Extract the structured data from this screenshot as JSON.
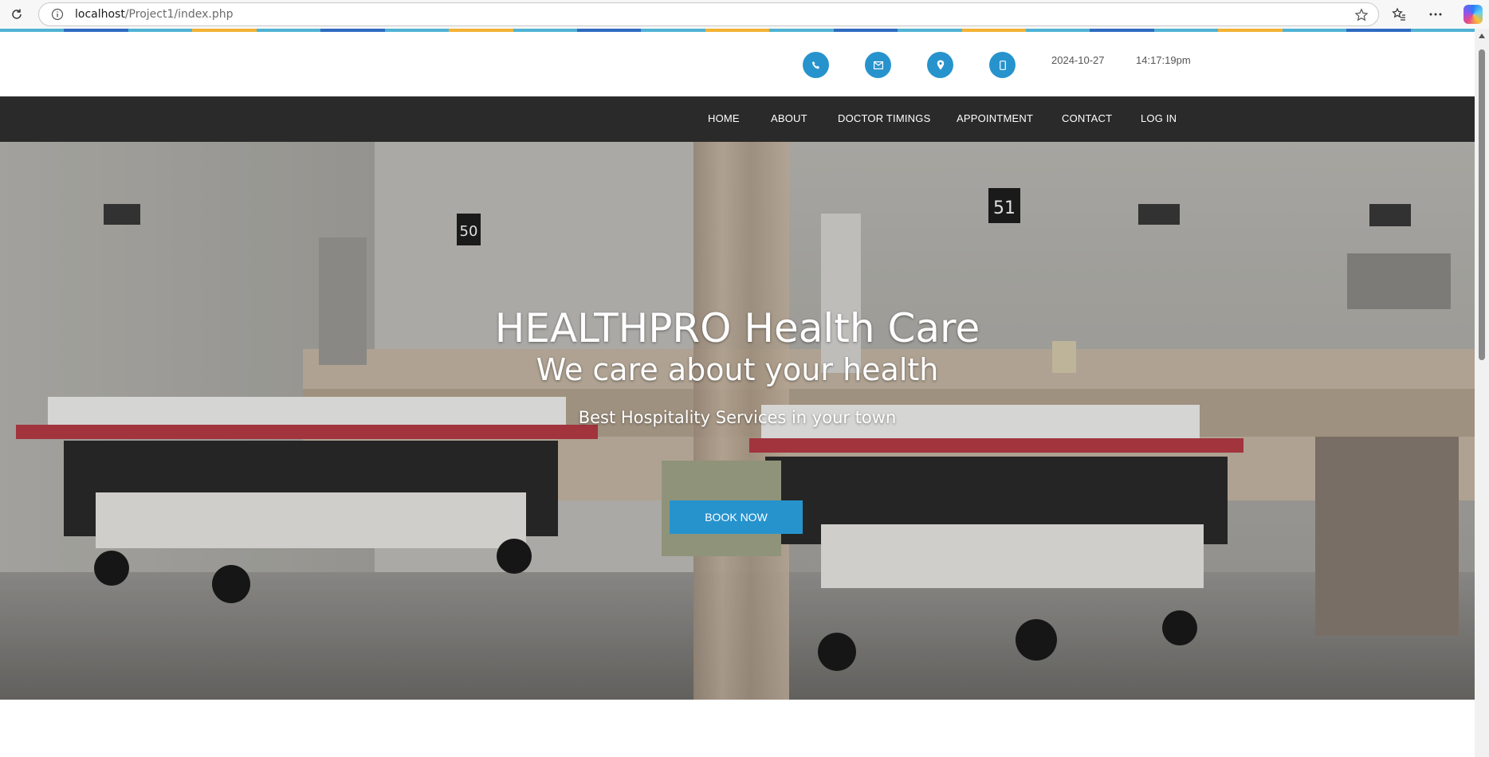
{
  "browser": {
    "url_host": "localhost",
    "url_path": "/Project1/index.php"
  },
  "theme": {
    "accent": "#2793cd",
    "nav_bg": "#2a2a2a",
    "strip_colors": [
      "#4fb3d4",
      "#2e6bc2",
      "#f2b233"
    ]
  },
  "contact_icons": [
    "phone-icon",
    "mail-icon",
    "location-pin-icon",
    "mobile-icon"
  ],
  "topbar": {
    "date": "2024-10-27",
    "time": "14:17:19pm"
  },
  "nav": {
    "items": [
      "HOME",
      "ABOUT",
      "DOCTOR TIMINGS",
      "APPOINTMENT",
      "CONTACT",
      "LOG IN"
    ]
  },
  "hero": {
    "title": "HEALTHPRO Health Care",
    "subtitle": "We care about your health",
    "tagline": "Best Hospitality Services in your town",
    "button_label": "BOOK NOW",
    "signs": [
      "50",
      "51"
    ]
  }
}
